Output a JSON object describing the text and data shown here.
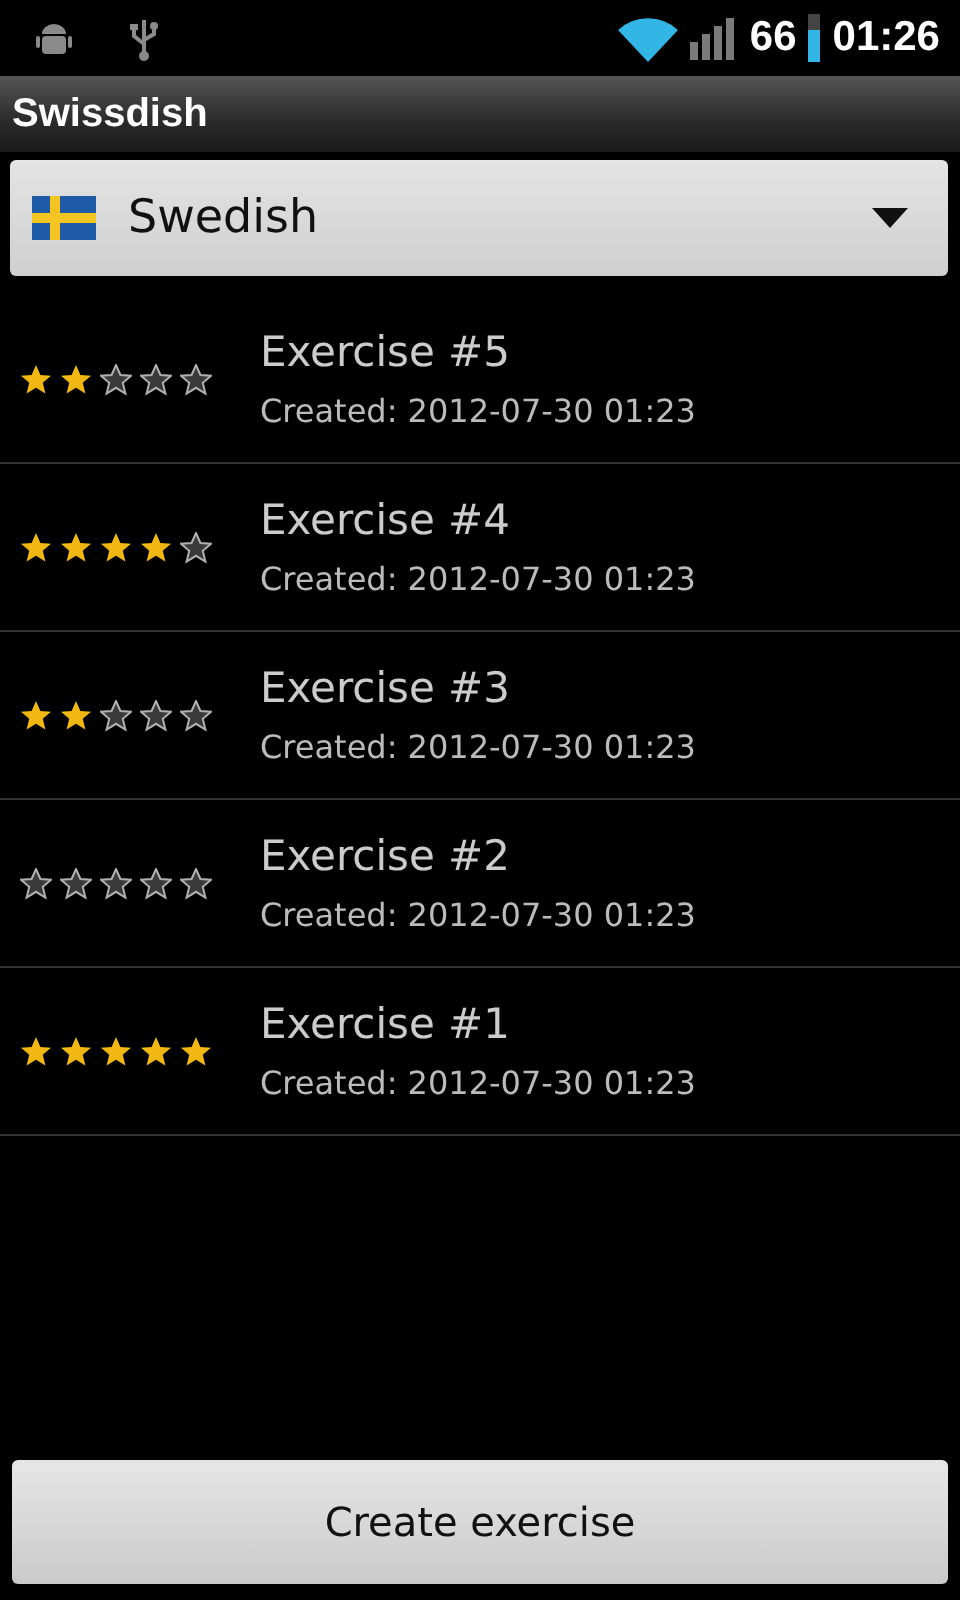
{
  "status_bar": {
    "battery": "66",
    "time": "01:26"
  },
  "title_bar": {
    "title": "Swissdish"
  },
  "language_spinner": {
    "value": "Swedish"
  },
  "exercises": [
    {
      "name": "Exercise #5",
      "created": "Created: 2012-07-30 01:23",
      "stars": 2
    },
    {
      "name": "Exercise #4",
      "created": "Created: 2012-07-30 01:23",
      "stars": 4
    },
    {
      "name": "Exercise #3",
      "created": "Created: 2012-07-30 01:23",
      "stars": 2
    },
    {
      "name": "Exercise #2",
      "created": "Created: 2012-07-30 01:23",
      "stars": 0
    },
    {
      "name": "Exercise #1",
      "created": "Created: 2012-07-30 01:23",
      "stars": 5
    }
  ],
  "buttons": [
    "Create exercise"
  ]
}
